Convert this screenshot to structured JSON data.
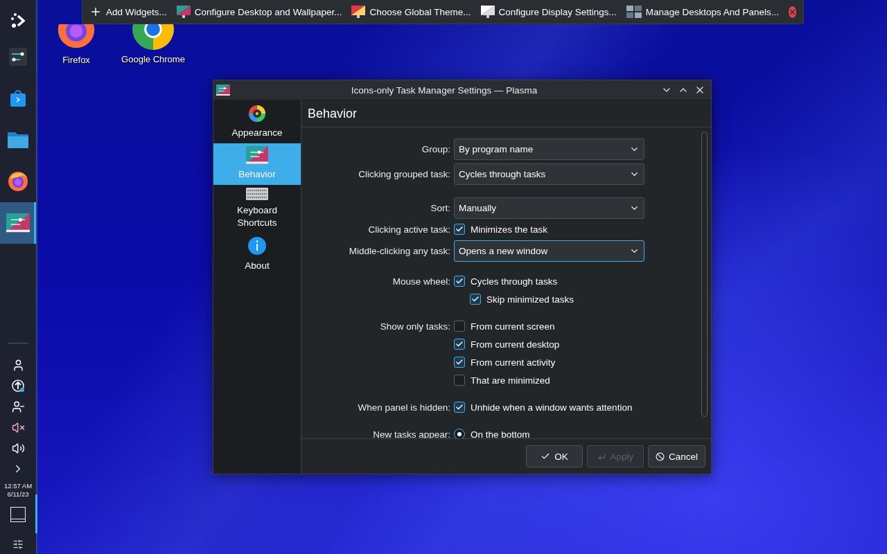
{
  "panel": {
    "launchers": [
      {
        "selected": false
      },
      {
        "selected": false
      },
      {
        "selected": false
      },
      {
        "selected": false
      },
      {
        "selected": true
      }
    ],
    "clock": {
      "time": "12:57 AM",
      "date": "6/11/23"
    }
  },
  "desktop_icons": [
    {
      "label": "Firefox"
    },
    {
      "label": "Google Chrome"
    }
  ],
  "edit_toolbar": {
    "items": [
      {
        "label": "Add Widgets..."
      },
      {
        "label": "Configure Desktop and Wallpaper..."
      },
      {
        "label": "Choose Global Theme..."
      },
      {
        "label": "Configure Display Settings..."
      },
      {
        "label": "Manage Desktops And Panels..."
      }
    ]
  },
  "dialog": {
    "title": "Icons-only Task Manager Settings — Plasma",
    "sidebar": [
      {
        "label": "Appearance",
        "selected": false
      },
      {
        "label": "Behavior",
        "selected": true
      },
      {
        "label": "Keyboard Shortcuts",
        "selected": false
      },
      {
        "label": "About",
        "selected": false
      }
    ],
    "page_title": "Behavior",
    "sections": [
      {
        "rows": [
          {
            "kind": "dropdown",
            "label": "Group:",
            "value": "By program name",
            "focused": false
          },
          {
            "kind": "dropdown",
            "label": "Clicking grouped task:",
            "value": "Cycles through tasks",
            "focused": false
          }
        ]
      },
      {
        "rows": [
          {
            "kind": "dropdown",
            "label": "Sort:",
            "value": "Manually",
            "focused": false
          },
          {
            "kind": "checkbox",
            "label": "Clicking active task:",
            "text": "Minimizes the task",
            "checked": true
          },
          {
            "kind": "dropdown",
            "label": "Middle-clicking any task:",
            "value": "Opens a new window",
            "focused": true
          }
        ]
      },
      {
        "rows": [
          {
            "kind": "checkbox",
            "label": "Mouse wheel:",
            "text": "Cycles through tasks",
            "checked": true,
            "children": [
              {
                "kind": "checkbox",
                "text": "Skip minimized tasks",
                "checked": true
              }
            ]
          }
        ]
      },
      {
        "rows": [
          {
            "kind": "checkbox",
            "label": "Show only tasks:",
            "text": "From current screen",
            "checked": false
          },
          {
            "kind": "checkbox",
            "text": "From current desktop",
            "checked": true
          },
          {
            "kind": "checkbox",
            "text": "From current activity",
            "checked": true
          },
          {
            "kind": "checkbox",
            "text": "That are minimized",
            "checked": false
          }
        ]
      },
      {
        "rows": [
          {
            "kind": "checkbox",
            "label": "When panel is hidden:",
            "text": "Unhide when a window wants attention",
            "checked": true
          }
        ]
      },
      {
        "rows": [
          {
            "kind": "radio",
            "label": "New tasks appear:",
            "text": "On the bottom",
            "selected": true
          }
        ]
      }
    ],
    "buttons": [
      {
        "kind": "ok",
        "label": "OK",
        "disabled": false
      },
      {
        "kind": "apply",
        "label": "Apply",
        "disabled": true
      },
      {
        "kind": "cancel",
        "label": "Cancel",
        "disabled": false
      }
    ]
  }
}
